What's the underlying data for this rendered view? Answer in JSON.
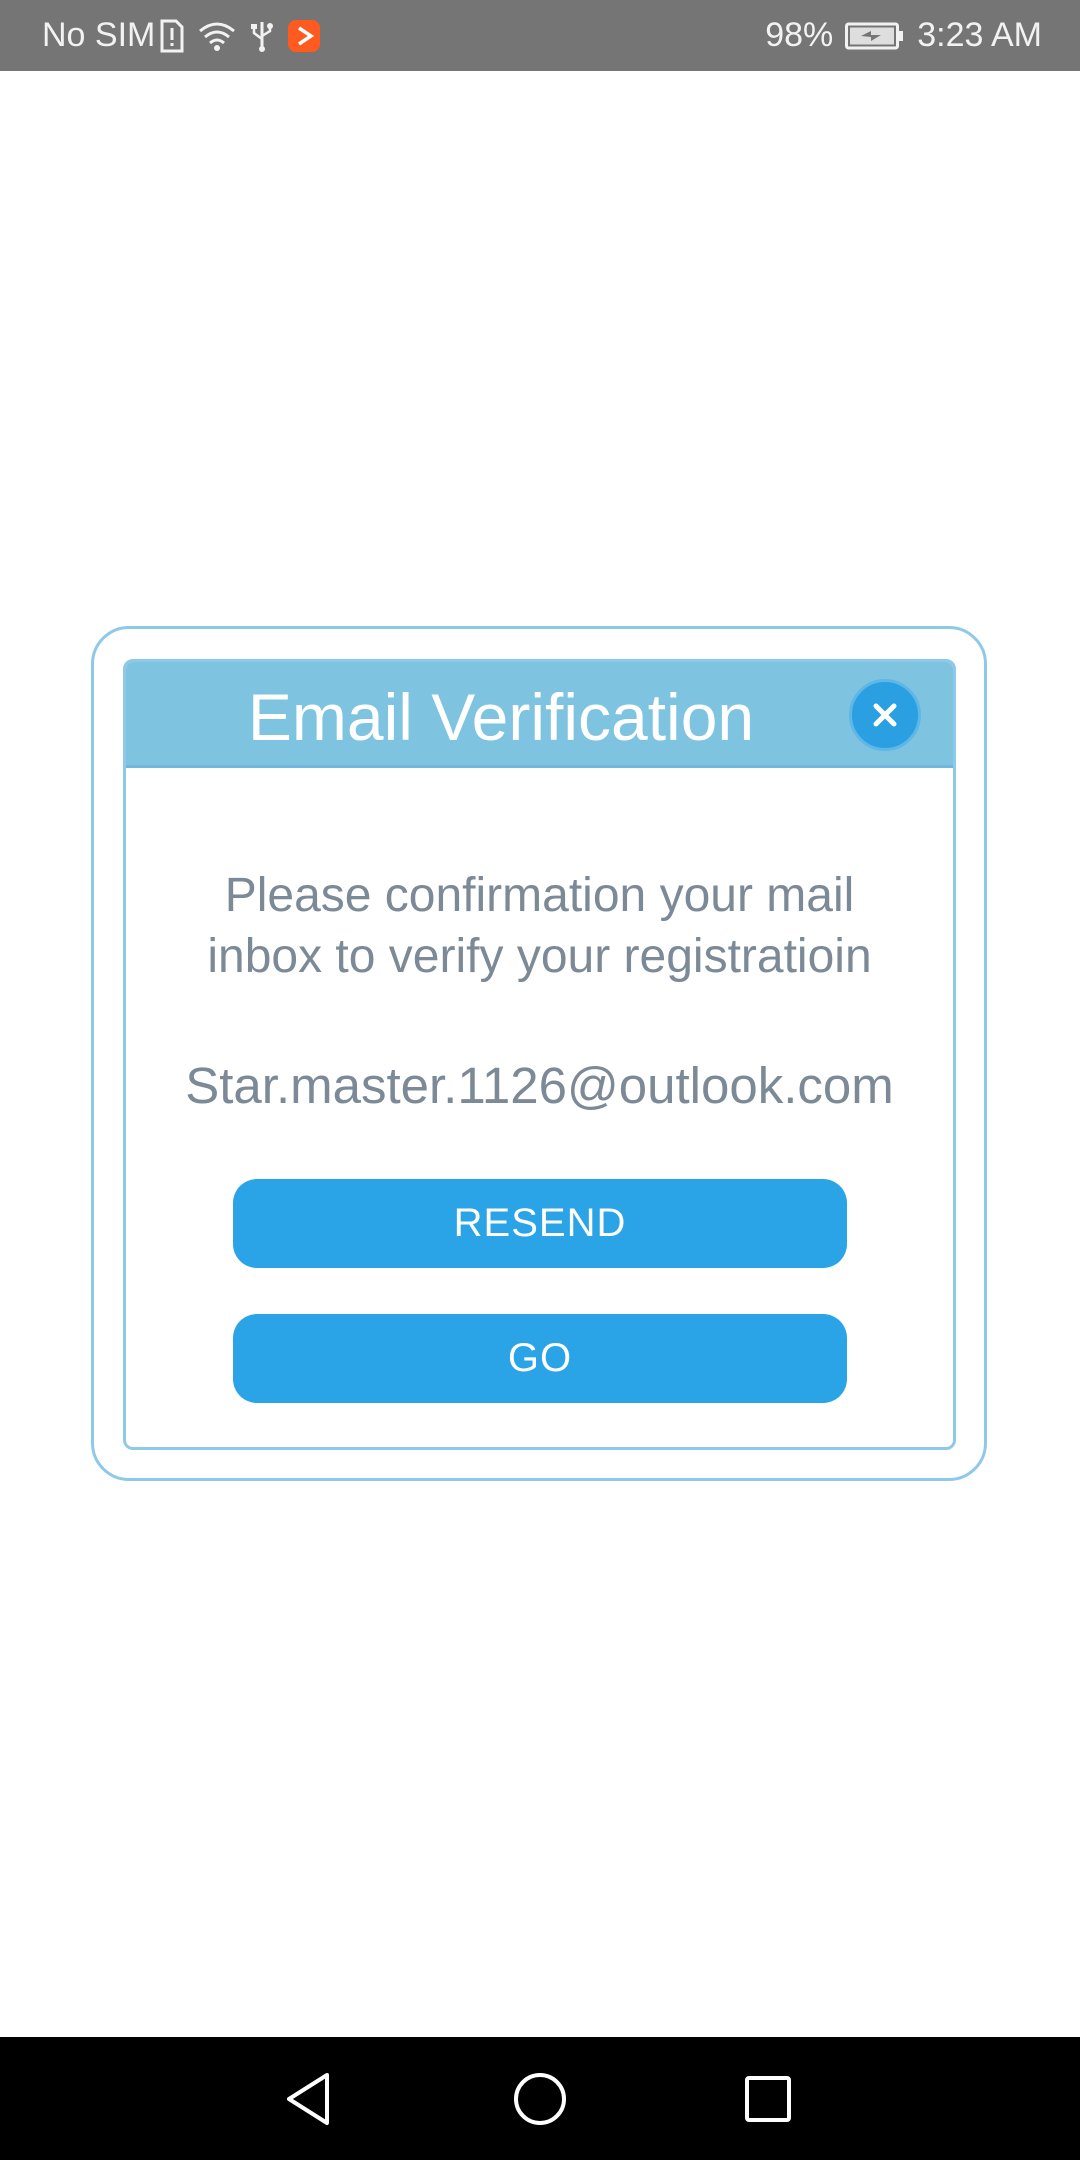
{
  "status_bar": {
    "carrier": "No SIM",
    "battery_percent": "98%",
    "time": "3:23 AM",
    "icons": [
      "sim-alert-icon",
      "wifi-icon",
      "usb-icon",
      "app-notification-icon",
      "battery-charging-icon"
    ],
    "colors": {
      "background": "#757575",
      "notification_app": "#ff5a1f"
    }
  },
  "dialog": {
    "title": "Email Verification",
    "close_icon": "close-icon",
    "message_line1": "Please confirmation your mail",
    "message_line2": "inbox to verify your registratioin",
    "email": "Star.master.1126@outlook.com",
    "resend_label": "RESEND",
    "go_label": "GO",
    "colors": {
      "header": "#7ec3e0",
      "border": "#8fc9ea",
      "button": "#2aa4e6",
      "text": "#7b8a96"
    }
  },
  "nav_bar": {
    "buttons": [
      "back-icon",
      "home-icon",
      "recents-icon"
    ]
  }
}
